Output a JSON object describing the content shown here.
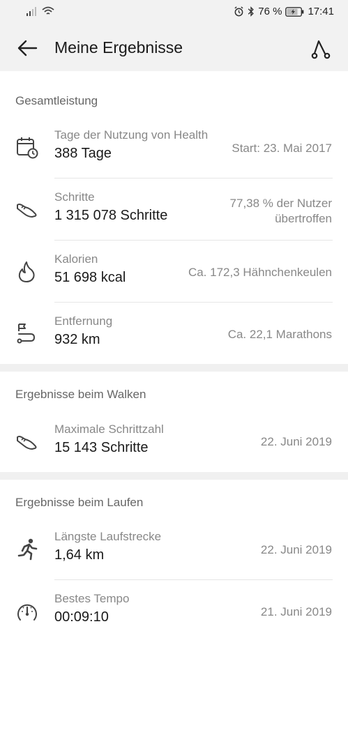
{
  "status": {
    "battery": "76 %",
    "time": "17:41"
  },
  "header": {
    "title": "Meine Ergebnisse"
  },
  "sections": {
    "overall": {
      "title": "Gesamtleistung",
      "rows": [
        {
          "label": "Tage der Nutzung von Health",
          "value": "388 Tage",
          "side": "Start: 23. Mai 2017",
          "icon": "calendar-icon"
        },
        {
          "label": "Schritte",
          "value": "1 315 078 Schritte",
          "side_line1": "77,38 % der Nutzer",
          "side_line2": "übertroffen",
          "icon": "shoe-icon"
        },
        {
          "label": "Kalorien",
          "value": "51 698 kcal",
          "side": "Ca. 172,3 Hähnchenkeulen",
          "icon": "flame-icon"
        },
        {
          "label": "Entfernung",
          "value": "932 km",
          "side": "Ca. 22,1 Marathons",
          "icon": "distance-icon"
        }
      ]
    },
    "walking": {
      "title": "Ergebnisse beim Walken",
      "rows": [
        {
          "label": "Maximale Schrittzahl",
          "value": "15 143 Schritte",
          "side": "22. Juni 2019",
          "icon": "shoe-icon"
        }
      ]
    },
    "running": {
      "title": "Ergebnisse beim Laufen",
      "rows": [
        {
          "label": "Längste Laufstrecke",
          "value": "1,64 km",
          "side": "22. Juni 2019",
          "icon": "runner-icon"
        },
        {
          "label": "Bestes Tempo",
          "value": "00:09:10",
          "side": "21. Juni 2019",
          "icon": "speedometer-icon"
        }
      ]
    }
  }
}
